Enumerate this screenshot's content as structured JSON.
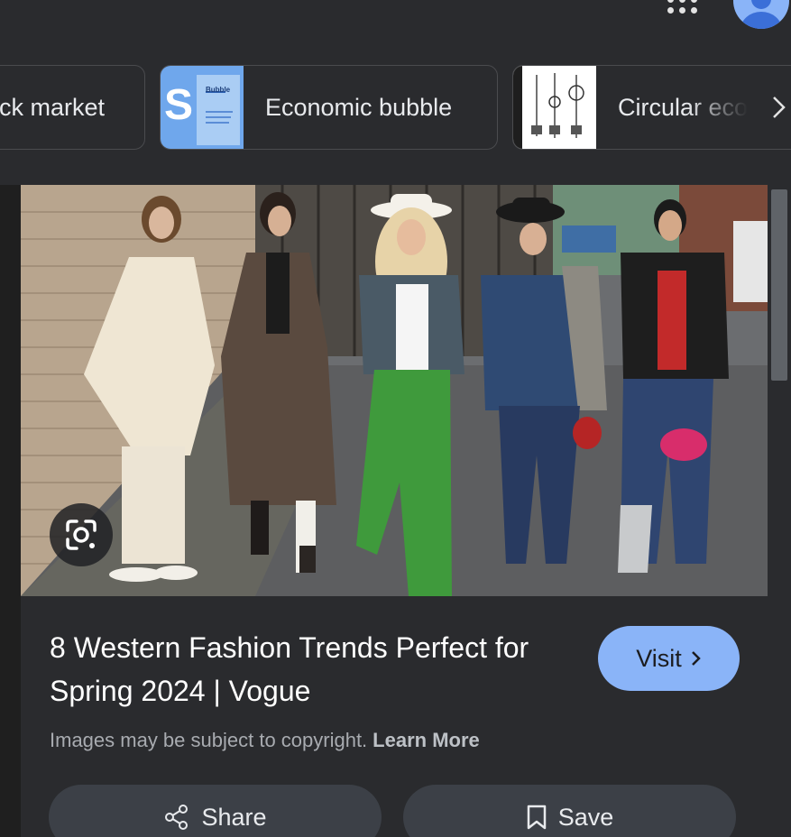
{
  "related_searches": [
    {
      "label": "ck market"
    },
    {
      "label": "Economic bubble",
      "thumb_title": "Bubble"
    },
    {
      "label": "Circular eco"
    }
  ],
  "result": {
    "title": "8 Western Fashion Trends Perfect for Spring 2024 | Vogue",
    "visit_label": "Visit",
    "copyright_text": "Images may be subject to copyright.",
    "learn_more_label": "Learn More",
    "share_label": "Share",
    "save_label": "Save"
  },
  "icons": {
    "apps": "apps-grid-icon",
    "account": "account-avatar-icon",
    "next": "chevron-right-icon",
    "lens": "google-lens-icon",
    "share": "share-icon",
    "save": "bookmark-icon"
  },
  "colors": {
    "accent": "#8ab4f8",
    "surface": "#2a2b2e",
    "button": "#3c4047"
  }
}
